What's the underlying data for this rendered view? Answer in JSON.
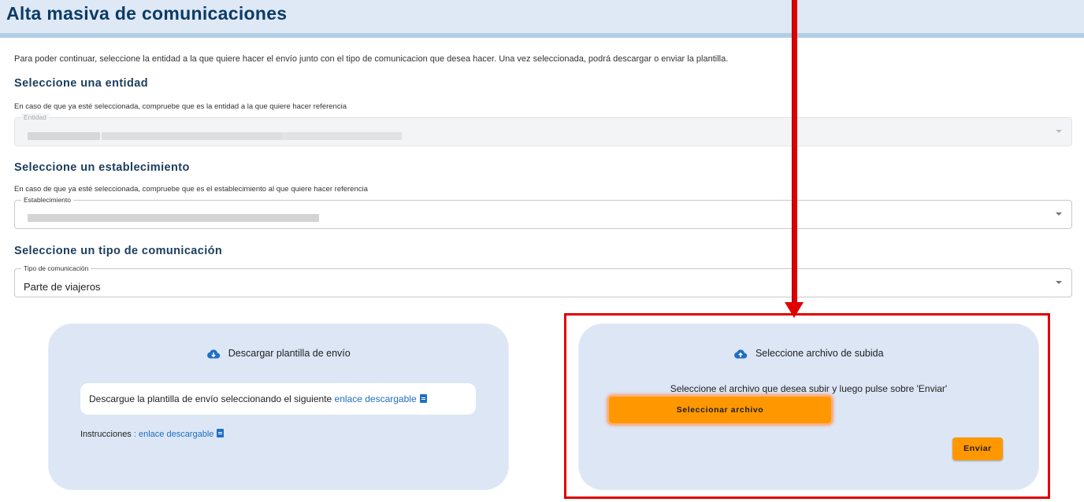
{
  "page": {
    "title": "Alta masiva de comunicaciones",
    "intro": "Para poder continuar, seleccione la entidad a la que quiere hacer el envío junto con el tipo de comunicacion que desea hacer. Una vez seleccionada, podrá descargar o enviar la plantilla."
  },
  "entity": {
    "section_title": "Seleccione una entidad",
    "hint": "En caso de que ya esté seleccionada, compruebe que es la entidad a la que quiere hacer referencia",
    "label": "Entidad",
    "value": "(redacted)"
  },
  "establishment": {
    "section_title": "Seleccione un establecimiento",
    "hint": "En caso de que ya esté seleccionada, compruebe que es el establecimiento al que quiere hacer referencia",
    "label": "Establecimiento",
    "value": "(redacted)"
  },
  "comm_type": {
    "section_title": "Seleccione un tipo de comunicación",
    "label": "Tipo de comunicación",
    "value": "Parte de viajeros"
  },
  "download_card": {
    "title": "Descargar plantilla de envío",
    "icon": "cloud-download-icon",
    "text": "Descargue la plantilla de envío seleccionando el siguiente",
    "link": "enlace descargable",
    "instructions_label": "Instrucciones",
    "instructions_sep": " : ",
    "instructions_link": "enlace descargable"
  },
  "upload_card": {
    "title": "Seleccione archivo de subida",
    "icon": "cloud-upload-icon",
    "text": "Seleccione el archivo que desea subir y luego pulse sobre 'Enviar'",
    "select_button": "Seleccionar archivo",
    "send_button": "Enviar"
  },
  "colors": {
    "accent_orange": "#ff9800",
    "link_blue": "#1f6fc2",
    "card_bg": "#dce6f5",
    "annotation_red": "#e00000",
    "title_blue": "#0b3b66"
  }
}
